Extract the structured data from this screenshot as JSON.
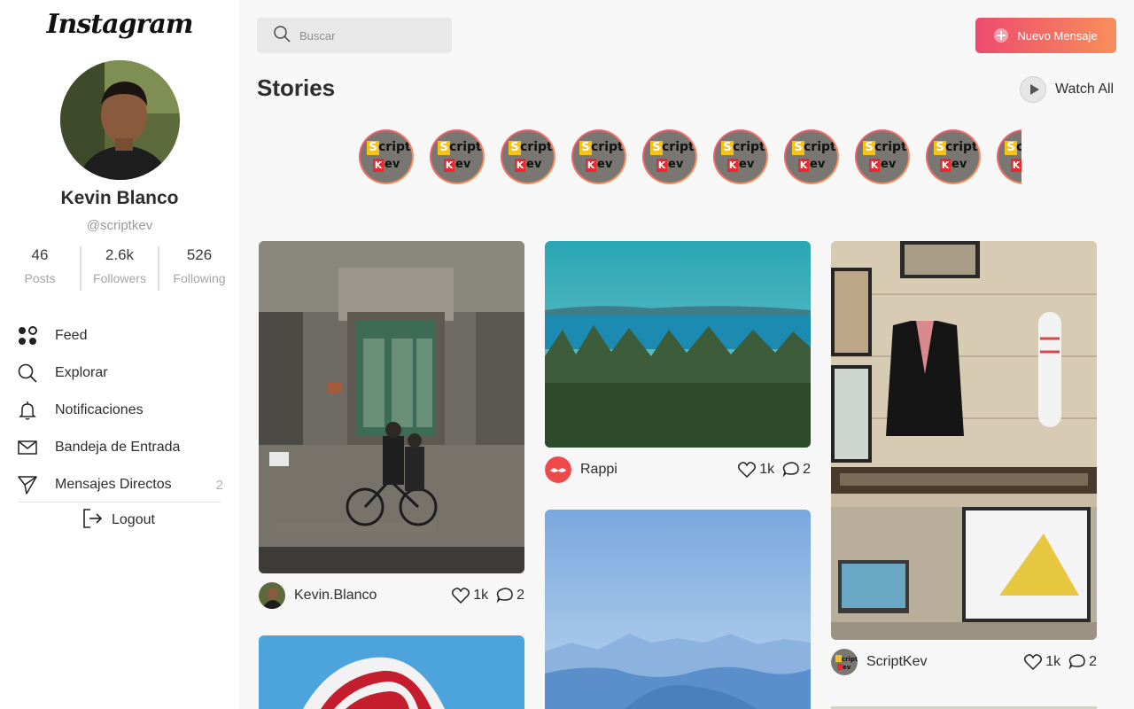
{
  "app": {
    "logo": "Instagram"
  },
  "profile": {
    "name": "Kevin Blanco",
    "handle": "@scriptkev",
    "stats": [
      {
        "value": "46",
        "label": "Posts"
      },
      {
        "value": "2.6k",
        "label": "Followers"
      },
      {
        "value": "526",
        "label": "Following"
      }
    ]
  },
  "nav": {
    "items": [
      {
        "label": "Feed",
        "icon": "grid-dots-icon"
      },
      {
        "label": "Explorar",
        "icon": "search-icon"
      },
      {
        "label": "Notificaciones",
        "icon": "bell-icon"
      },
      {
        "label": "Bandeja de Entrada",
        "icon": "mail-icon"
      },
      {
        "label": "Mensajes Directos",
        "icon": "send-icon",
        "badge": "2"
      }
    ],
    "logout": "Logout"
  },
  "header": {
    "search_placeholder": "Buscar",
    "new_message": "Nuevo Mensaje"
  },
  "stories": {
    "title": "Stories",
    "watch_all": "Watch All",
    "items": [
      {
        "logo_top": "cript",
        "logo_bottom": "ev",
        "logo_s": "S",
        "logo_k": "K"
      },
      {
        "logo_top": "cript",
        "logo_bottom": "ev",
        "logo_s": "S",
        "logo_k": "K"
      },
      {
        "logo_top": "cript",
        "logo_bottom": "ev",
        "logo_s": "S",
        "logo_k": "K"
      },
      {
        "logo_top": "cript",
        "logo_bottom": "ev",
        "logo_s": "S",
        "logo_k": "K"
      },
      {
        "logo_top": "cript",
        "logo_bottom": "ev",
        "logo_s": "S",
        "logo_k": "K"
      },
      {
        "logo_top": "cript",
        "logo_bottom": "ev",
        "logo_s": "S",
        "logo_k": "K"
      },
      {
        "logo_top": "cript",
        "logo_bottom": "ev",
        "logo_s": "S",
        "logo_k": "K"
      },
      {
        "logo_top": "cript",
        "logo_bottom": "ev",
        "logo_s": "S",
        "logo_k": "K"
      },
      {
        "logo_top": "cript",
        "logo_bottom": "ev",
        "logo_s": "S",
        "logo_k": "K"
      },
      {
        "logo_top": "cript",
        "logo_bottom": "ev",
        "logo_s": "S",
        "logo_k": "K"
      }
    ]
  },
  "posts": [
    {
      "user": "Kevin.Blanco",
      "likes": "1k",
      "comments": "2"
    },
    {
      "user": "Rappi",
      "likes": "1k",
      "comments": "2"
    },
    {
      "user": "ScriptKev",
      "likes": "1k",
      "comments": "2"
    }
  ],
  "colors": {
    "accent_start": "#ee4a6e",
    "accent_end": "#f78f5b",
    "rappi": "#ee4a4a"
  }
}
